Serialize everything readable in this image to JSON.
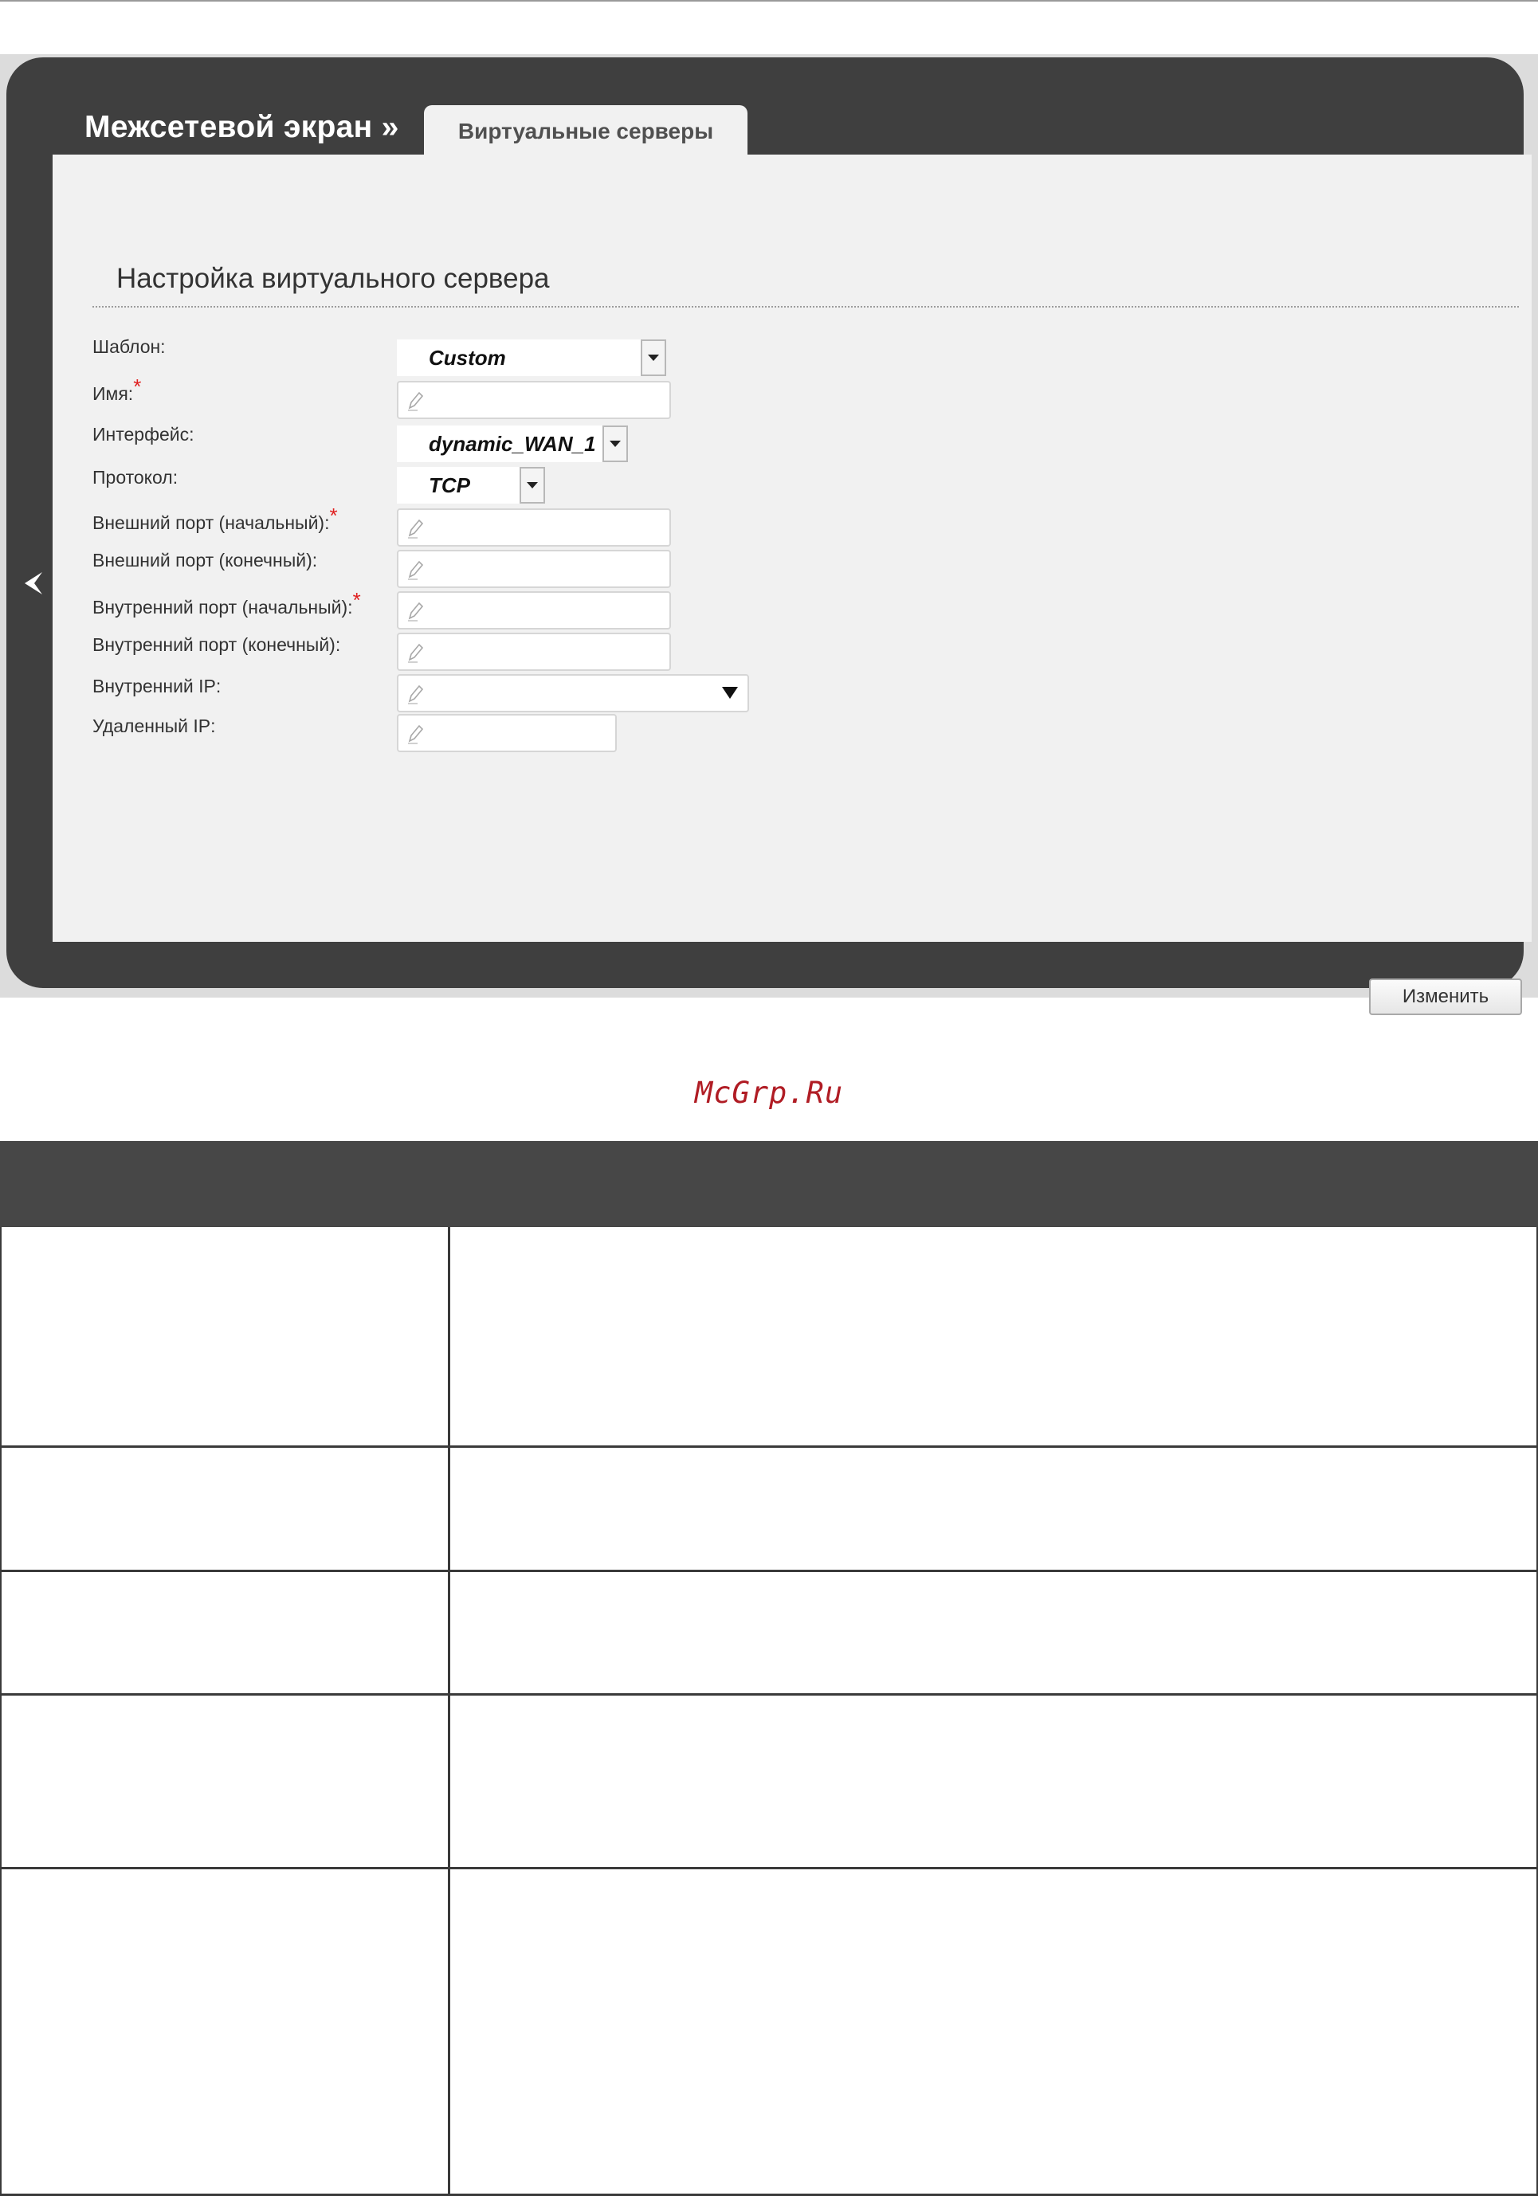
{
  "section_title": "Межсетевой экран »",
  "tab_label": "Виртуальные серверы",
  "form": {
    "title": "Настройка виртуального сервера",
    "template_label": "Шаблон:",
    "template_value": "Custom",
    "name_label": "Имя:",
    "interface_label": "Интерфейс:",
    "interface_value": "dynamic_WAN_1",
    "protocol_label": "Протокол:",
    "protocol_value": "TCP",
    "ext_port_start_label": "Внешний порт (начальный):",
    "ext_port_end_label": "Внешний порт (конечный):",
    "int_port_start_label": "Внутренний порт (начальный):",
    "int_port_end_label": "Внутренний порт (конечный):",
    "internal_ip_label": "Внутренний IP:",
    "remote_ip_label": "Удаленный IP:",
    "required_mark": "*",
    "save_button": "Изменить"
  },
  "watermark": "McGrp.Ru",
  "icons": {
    "back": "back-chevron-icon",
    "pencil": "pencil-icon",
    "dropdown": "dropdown-arrow-icon"
  },
  "colors": {
    "frame": "#3f3f3f",
    "panel": "#f1f1f1",
    "required": "#e02020",
    "watermark": "#b01c24",
    "table_header": "#474747"
  }
}
